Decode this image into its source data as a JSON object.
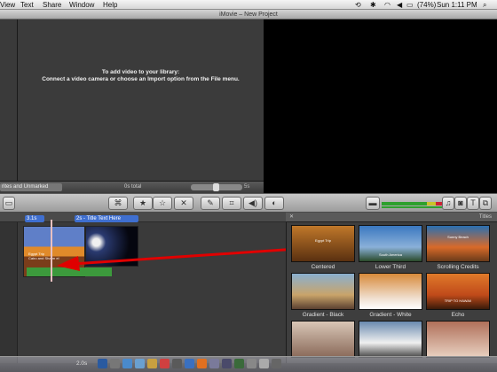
{
  "menubar": {
    "items": [
      "View",
      "Text",
      "Share",
      "Window",
      "Help"
    ],
    "battery": "(74%)",
    "clock": "Sun 1:11 PM"
  },
  "window": {
    "title": "iMovie – New Project"
  },
  "library": {
    "message_line1": "To add video to your library:",
    "message_line2": "Connect a video camera or choose an Import option from the File menu.",
    "filter": "rites and Unmarked",
    "total": "0s total",
    "zoom": "5s"
  },
  "toolbar": {
    "icons": [
      "keyword-icon",
      "favorite-star-icon",
      "unmark-star-icon",
      "reject-icon",
      "eyedropper-icon",
      "crop-icon",
      "audio-icon",
      "color-adjust-icon",
      "music-icon",
      "camera-icon",
      "text-icon",
      "transition-icon"
    ]
  },
  "project": {
    "clip1_tag": "3.1s",
    "clip2_tag": "2s - Title Text Here",
    "clip1_title": "Egypt Trip",
    "clip1_sub": "Cairo and Sharm el",
    "duration": "2.0s"
  },
  "titles_browser": {
    "header": "Titles",
    "items": [
      {
        "label": "Centered",
        "overlay": "Egypt Trip",
        "bg": "#c0782a"
      },
      {
        "label": "Lower Third",
        "overlay": "South America",
        "bg": "#3a78c0"
      },
      {
        "label": "Scrolling Credits",
        "overlay": "Sunny Beach",
        "bg": "#2a6fb0"
      },
      {
        "label": "Gradient - Black",
        "overlay": "",
        "bg": "#c9a46a"
      },
      {
        "label": "Gradient - White",
        "overlay": "",
        "bg": "#d88a3a"
      },
      {
        "label": "Echo",
        "overlay": "TRIP TO HAWAII",
        "bg": "#e07a2a"
      },
      {
        "label": "",
        "overlay": "",
        "bg": "#d9c6b6"
      },
      {
        "label": "",
        "overlay": "",
        "bg": "#6a8ab0"
      },
      {
        "label": "",
        "overlay": "",
        "bg": "#b0705a"
      }
    ]
  },
  "colors": {
    "accent": "#3f6fd0",
    "arrow": "#e00000",
    "audio_green": "#2ea02e"
  }
}
